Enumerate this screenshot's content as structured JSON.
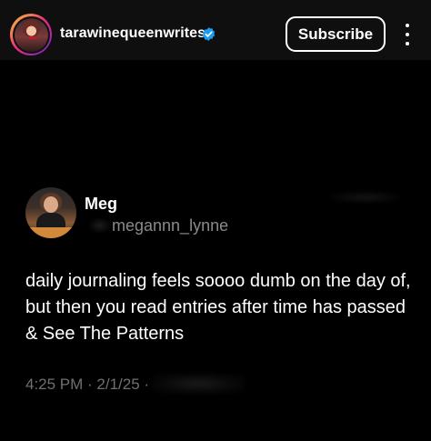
{
  "header": {
    "username": "tarawinequeenwrites",
    "avatar_icon": "profile-avatar",
    "verified_icon": "verified-badge-icon",
    "subscribe_label": "Subscribe",
    "more_icon": "more-vertical-icon",
    "colors": {
      "background": "#0f0f0f",
      "verified": "#1d9bf0",
      "avatar_ring": [
        "#f9ce34",
        "#ee2a7b",
        "#6228d7"
      ]
    }
  },
  "post": {
    "display_name": "Meg",
    "handle": "megannn_lynne",
    "text": "daily journaling feels soooo dumb on the day of, but then you read entries after time has passed & See The Patterns",
    "timestamp": "4:25 PM · 2/1/25 ·",
    "colors": {
      "background": "#000000",
      "text": "#ffffff",
      "muted": "#8a8a8a"
    }
  }
}
